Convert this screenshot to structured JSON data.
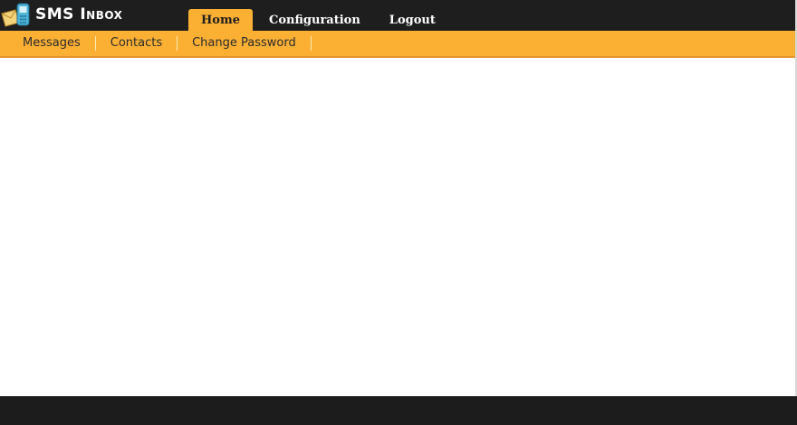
{
  "app": {
    "title": "SMS Inbox",
    "logo_icon": "phone-envelope-icon"
  },
  "main_nav": {
    "tabs": [
      {
        "label": "Home",
        "active": true
      },
      {
        "label": "Configuration",
        "active": false
      },
      {
        "label": "Logout",
        "active": false
      }
    ]
  },
  "sub_nav": {
    "items": [
      {
        "label": "Messages"
      },
      {
        "label": "Contacts"
      },
      {
        "label": "Change Password"
      }
    ]
  },
  "colors": {
    "header_bg": "#1e1e1e",
    "accent": "#fbb034",
    "footer_bg": "#1c1c1c"
  }
}
